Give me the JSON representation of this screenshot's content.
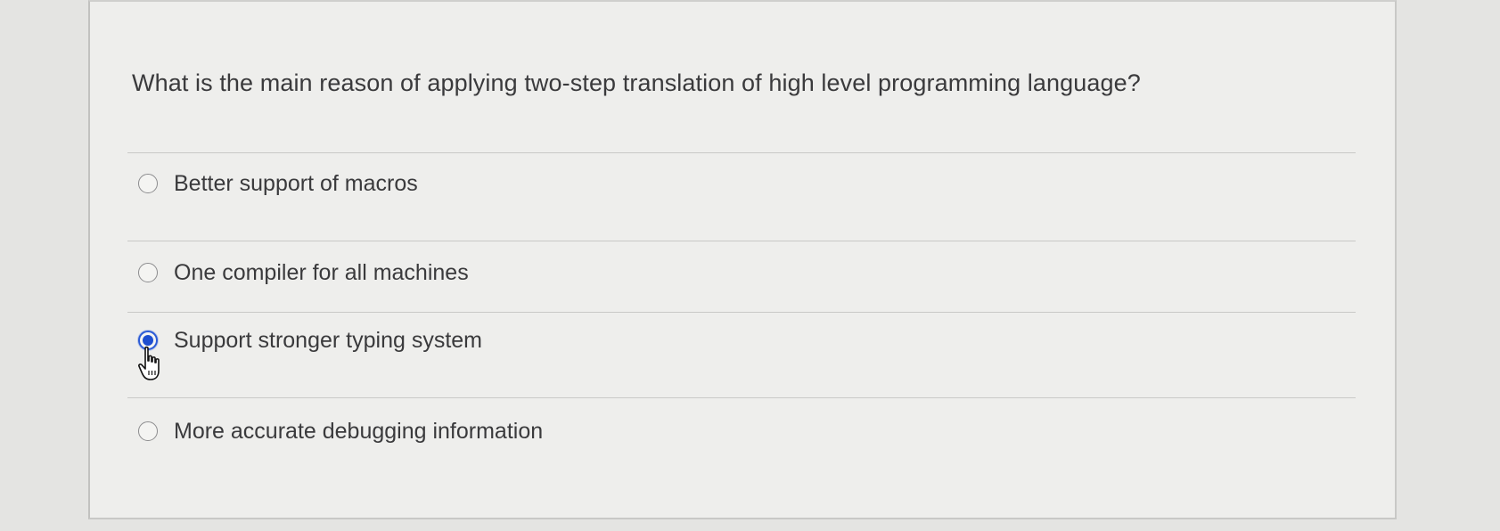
{
  "question": {
    "text": "What is the main reason of applying two-step translation of high level programming language?"
  },
  "options": [
    {
      "label": "Better support of macros",
      "selected": false
    },
    {
      "label": "One compiler for all machines",
      "selected": false
    },
    {
      "label": "Support stronger typing system",
      "selected": true
    },
    {
      "label": "More accurate debugging information",
      "selected": false
    }
  ],
  "colors": {
    "radio_selected": "#1d4ed0",
    "text": "#3a3a3c",
    "background": "#eeeeec"
  },
  "cursor": {
    "icon": "hand-pointer-icon"
  }
}
